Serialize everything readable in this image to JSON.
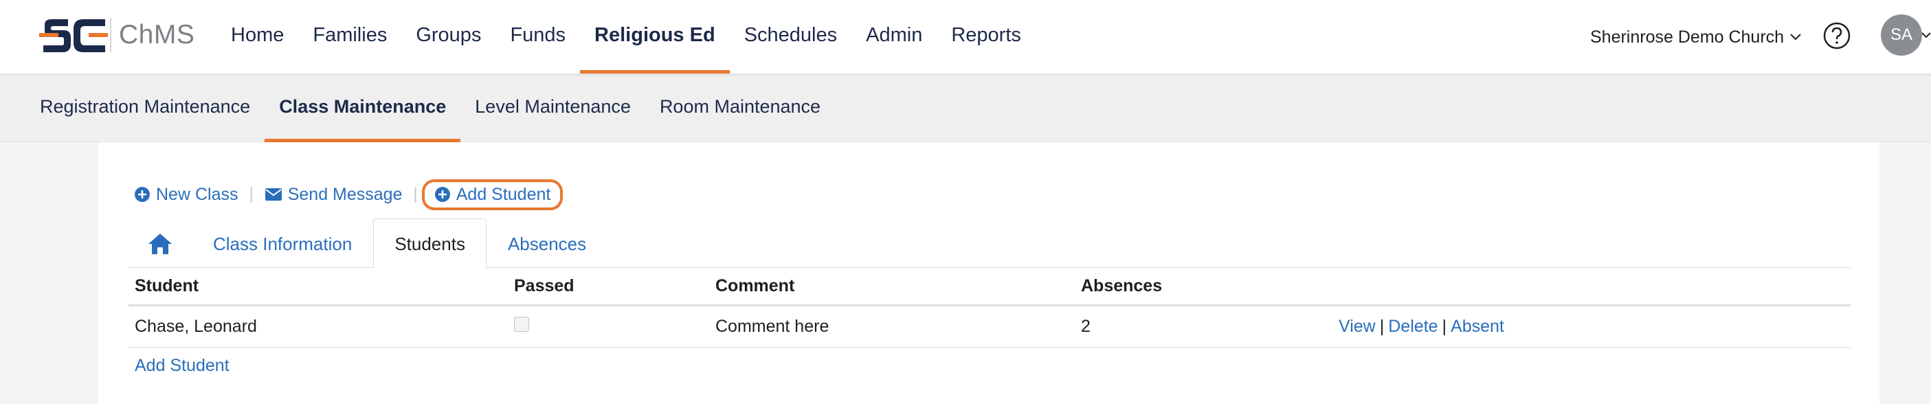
{
  "brand": {
    "app_name": "ChMS",
    "colors": {
      "navy": "#1c2a4a",
      "orange": "#e8782f",
      "link": "#2a6ebb"
    }
  },
  "topnav": {
    "items": [
      {
        "label": "Home",
        "active": false
      },
      {
        "label": "Families",
        "active": false
      },
      {
        "label": "Groups",
        "active": false
      },
      {
        "label": "Funds",
        "active": false
      },
      {
        "label": "Religious Ed",
        "active": true
      },
      {
        "label": "Schedules",
        "active": false
      },
      {
        "label": "Admin",
        "active": false
      },
      {
        "label": "Reports",
        "active": false
      }
    ],
    "church_name": "Sherinrose Demo Church",
    "avatar_initials": "SA"
  },
  "subnav": {
    "items": [
      {
        "label": "Registration Maintenance",
        "active": false
      },
      {
        "label": "Class Maintenance",
        "active": true
      },
      {
        "label": "Level Maintenance",
        "active": false
      },
      {
        "label": "Room Maintenance",
        "active": false
      }
    ]
  },
  "actions": {
    "new_class": "New Class",
    "send_message": "Send Message",
    "add_student": "Add Student"
  },
  "tabs": {
    "home_icon": "home-icon",
    "items": [
      {
        "label": "Class Information",
        "active": false
      },
      {
        "label": "Students",
        "active": true
      },
      {
        "label": "Absences",
        "active": false
      }
    ]
  },
  "table": {
    "headers": [
      "Student",
      "Passed",
      "Comment",
      "Absences",
      ""
    ],
    "rows": [
      {
        "student": "Chase, Leonard",
        "passed": false,
        "comment": "Comment here",
        "absences": "2",
        "actions": {
          "view": "View",
          "delete": "Delete",
          "absent": "Absent",
          "separator": "|"
        }
      }
    ],
    "add_link": "Add Student"
  }
}
